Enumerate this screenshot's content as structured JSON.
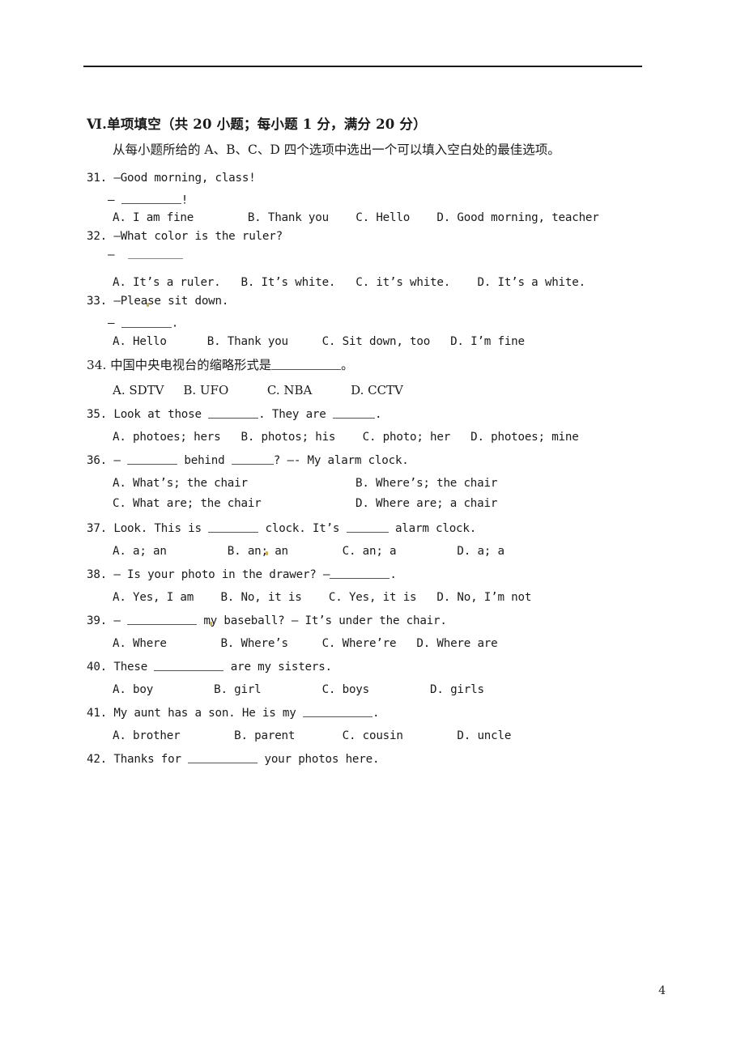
{
  "page": {
    "number": "4"
  },
  "section": {
    "heading": "Ⅵ.单项填空（共 20 小题；每小题 1 分，满分 20 分）",
    "instruction": "从每小题所给的 A、B、C、D 四个选项中选出一个可以填入空白处的最佳选项。"
  },
  "questions": [
    {
      "number": "31.",
      "stem_pre": "—Good morning, class!",
      "reply_dash": "—",
      "reply_post": "!",
      "options": "A. I am fine        B. Thank you    C. Hello    D. Good morning, teacher"
    },
    {
      "number": "32.",
      "stem_pre": "—What color is the ruler?",
      "reply_dash": "—",
      "options": "A. It’s a ruler.   B. It’s white.   C. it’s white.    D. It’s a white."
    },
    {
      "number": "33.",
      "stem_pre": "—Please sit down.",
      "reply_dash": "—",
      "reply_post": ".",
      "options": "A. Hello      B. Thank you     C. Sit down, too   D. I’m fine"
    },
    {
      "number": "34.",
      "stem_pre": "中国中央电视台的缩略形式是",
      "stem_post": "。",
      "options": "A. SDTV     B. UFO          C. NBA          D. CCTV"
    },
    {
      "number": "35.",
      "stem_pre": "Look at those ",
      "stem_mid": ". They are ",
      "stem_post": ".",
      "options": "A. photoes; hers   B. photos; his    C. photo; her   D. photoes; mine"
    },
    {
      "number": "36.",
      "stem_dash": "— ",
      "stem_mid": " behind ",
      "stem_post": "?     —- My alarm clock.",
      "option_a": "A. What’s; the chair",
      "option_b": "B. Where’s; the chair",
      "option_c": "C. What are; the chair",
      "option_d": "D. Where are; a chair"
    },
    {
      "number": "37.",
      "stem_pre": "Look. This is ",
      "stem_mid": " clock. It’s ",
      "stem_post": " alarm clock.",
      "options": "A. a; an         B. an; an        C. an; a         D. a; a"
    },
    {
      "number": "38.",
      "stem_pre": "— Is your photo in the drawer? —",
      "stem_post": ".",
      "options": "A. Yes, I am    B. No, it is    C. Yes, it is   D. No, I’m not"
    },
    {
      "number": "39.",
      "stem_dash": "— ",
      "stem_post": " my baseball?   — It’s under the chair.",
      "options": "A. Where        B. Where’s     C. Where’re   D. Where are"
    },
    {
      "number": "40.",
      "stem_pre": "These ",
      "stem_post": " are my sisters.",
      "options": "A. boy         B. girl         C. boys         D. girls"
    },
    {
      "number": "41.",
      "stem_pre": "My aunt has a son. He is my ",
      "stem_post": ".",
      "options": "A. brother        B. parent       C. cousin        D. uncle"
    },
    {
      "number": "42.",
      "stem_pre": "Thanks for ",
      "stem_post": " your photos here."
    }
  ]
}
